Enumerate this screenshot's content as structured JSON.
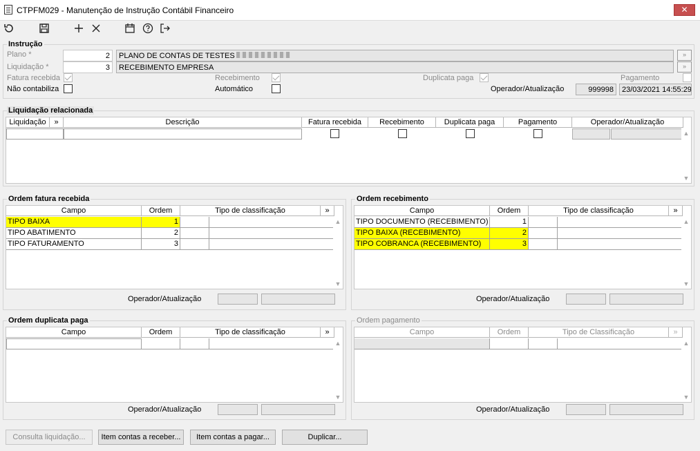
{
  "window": {
    "title": "CTPFM029 - Manutenção de Instrução Contábil Financeiro",
    "close_label": "✕"
  },
  "toolbar": {
    "refresh": "↻",
    "save": "💾",
    "add": "+",
    "delete": "✕",
    "calendar": "📅",
    "help": "?",
    "exit": "↦"
  },
  "instrucao": {
    "title": "Instrução",
    "plano_label": "Plano *",
    "plano_value": "2",
    "plano_desc": "PLANO DE CONTAS DE TESTES",
    "liquidacao_label": "Liquidação *",
    "liquidacao_value": "3",
    "liquidacao_desc": "RECEBIMENTO EMPRESA",
    "fatura_recebida_label": "Fatura recebida",
    "recebimento_label": "Recebimento",
    "duplicata_paga_label": "Duplicata paga",
    "pagamento_label": "Pagamento",
    "nao_contabiliza_label": "Não contabiliza",
    "automatico_label": "Automático",
    "operador_label": "Operador/Atualização",
    "operador_value": "999998",
    "atualizacao_value": "23/03/2021 14:55:29",
    "lookup_label": "»"
  },
  "liq_rel": {
    "title": "Liquidação relacionada",
    "headers": {
      "liquidacao": "Liquidação",
      "more": "»",
      "descricao": "Descrição",
      "fatura": "Fatura recebida",
      "recebimento": "Recebimento",
      "duplicata": "Duplicata paga",
      "pagamento": "Pagamento",
      "operador": "Operador/Atualização"
    }
  },
  "ordem_fatura": {
    "title": "Ordem fatura recebida",
    "headers": {
      "campo": "Campo",
      "ordem": "Ordem",
      "tipo": "Tipo de classificação",
      "more": "»"
    },
    "rows": [
      {
        "campo": "TIPO BAIXA",
        "ordem": "1"
      },
      {
        "campo": "TIPO ABATIMENTO",
        "ordem": "2"
      },
      {
        "campo": "TIPO FATURAMENTO",
        "ordem": "3"
      }
    ],
    "operador_label": "Operador/Atualização"
  },
  "ordem_recebimento": {
    "title": "Ordem recebimento",
    "headers": {
      "campo": "Campo",
      "ordem": "Ordem",
      "tipo": "Tipo de classificação",
      "more": "»"
    },
    "rows": [
      {
        "campo": "TIPO DOCUMENTO (RECEBIMENTO)",
        "ordem": "1"
      },
      {
        "campo": "TIPO BAIXA (RECEBIMENTO)",
        "ordem": "2"
      },
      {
        "campo": "TIPO COBRANCA (RECEBIMENTO)",
        "ordem": "3"
      }
    ],
    "operador_label": "Operador/Atualização"
  },
  "ordem_duplicata": {
    "title": "Ordem duplicata paga",
    "headers": {
      "campo": "Campo",
      "ordem": "Ordem",
      "tipo": "Tipo de classificação",
      "more": "»"
    },
    "operador_label": "Operador/Atualização"
  },
  "ordem_pagamento": {
    "title": "Ordem pagamento",
    "headers": {
      "campo": "Campo",
      "ordem": "Ordem",
      "tipo": "Tipo de Classificação",
      "more": "»"
    },
    "operador_label": "Operador/Atualização"
  },
  "buttons": {
    "consulta": "Consulta liquidação...",
    "item_receber": "Item contas a receber...",
    "item_pagar": "Item contas a pagar...",
    "duplicar": "Duplicar..."
  },
  "colors": {
    "highlight": "#ffff00",
    "close": "#c75050"
  }
}
